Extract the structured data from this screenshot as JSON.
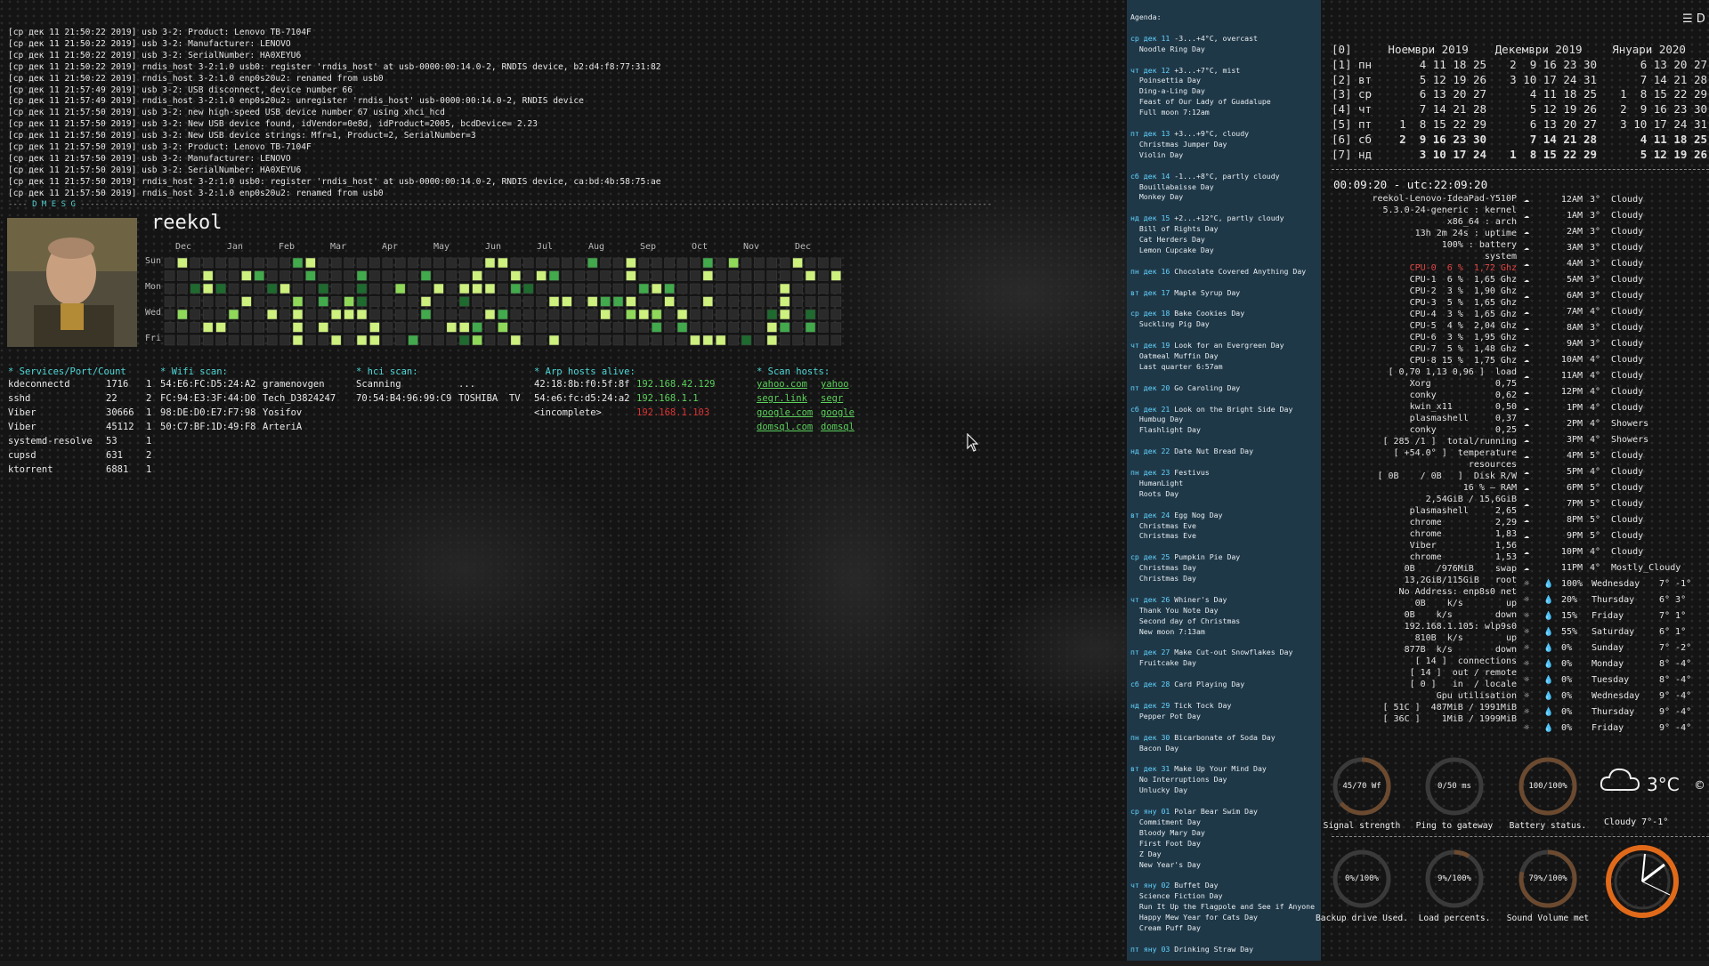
{
  "top_right": {
    "menu_label": "D"
  },
  "dmesg": {
    "lines": [
      "[ср дек 11 21:50:22 2019] usb 3-2: Product: Lenovo TB-7104F",
      "[ср дек 11 21:50:22 2019] usb 3-2: Manufacturer: LENOVO",
      "[ср дек 11 21:50:22 2019] usb 3-2: SerialNumber: HA0XEYU6",
      "[ср дек 11 21:50:22 2019] rndis_host 3-2:1.0 usb0: register 'rndis_host' at usb-0000:00:14.0-2, RNDIS device, b2:d4:f8:77:31:82",
      "[ср дек 11 21:50:22 2019] rndis_host 3-2:1.0 enp0s20u2: renamed from usb0",
      "[ср дек 11 21:57:49 2019] usb 3-2: USB disconnect, device number 66",
      "[ср дек 11 21:57:49 2019] rndis_host 3-2:1.0 enp0s20u2: unregister 'rndis_host' usb-0000:00:14.0-2, RNDIS device",
      "[ср дек 11 21:57:50 2019] usb 3-2: new high-speed USB device number 67 using xhci_hcd",
      "[ср дек 11 21:57:50 2019] usb 3-2: New USB device found, idVendor=0e8d, idProduct=2005, bcdDevice= 2.23",
      "[ср дек 11 21:57:50 2019] usb 3-2: New USB device strings: Mfr=1, Product=2, SerialNumber=3",
      "[ср дек 11 21:57:50 2019] usb 3-2: Product: Lenovo TB-7104F",
      "[ср дек 11 21:57:50 2019] usb 3-2: Manufacturer: LENOVO",
      "[ср дек 11 21:57:50 2019] usb 3-2: SerialNumber: HA0XEYU6",
      "[ср дек 11 21:57:50 2019] rndis_host 3-2:1.0 usb0: register 'rndis_host' at usb-0000:00:14.0-2, RNDIS device, ca:bd:4b:58:75:ae",
      "[ср дек 11 21:57:50 2019] rndis_host 3-2:1.0 enp0s20u2: renamed from usb0"
    ],
    "separator_label": "D M E S G"
  },
  "profile": {
    "username": "reekol",
    "months": [
      "Dec",
      "Jan",
      "Feb",
      "Mar",
      "Apr",
      "May",
      "Jun",
      "Jul",
      "Aug",
      "Sep",
      "Oct",
      "Nov",
      "Dec"
    ],
    "days": [
      "Sun",
      "Mon",
      "Wed",
      "Fri"
    ]
  },
  "services": {
    "title": "* Services/Port/Count",
    "rows": [
      [
        "kdeconnectd",
        "1716",
        "1"
      ],
      [
        "sshd",
        "22",
        "2"
      ],
      [
        "Viber",
        "30666",
        "1"
      ],
      [
        "Viber",
        "45112",
        "1"
      ],
      [
        "systemd-resolve",
        "53",
        "1"
      ],
      [
        "cupsd",
        "631",
        "2"
      ],
      [
        "ktorrent",
        "6881",
        "1"
      ]
    ]
  },
  "wifi": {
    "title": "* Wifi scan:",
    "rows": [
      [
        "54:E6:FC:D5:24:A2",
        "gramenovgen"
      ],
      [
        "FC:94:E3:3F:44:D0",
        "Tech_D3824247"
      ],
      [
        "98:DE:D0:E7:F7:98",
        "Yosifov"
      ],
      [
        "50:C7:BF:1D:49:F8",
        "ArteriA"
      ]
    ]
  },
  "hci": {
    "title": "* hci scan:",
    "rows": [
      [
        "Scanning",
        "..."
      ],
      [
        "70:54:B4:96:99:C9",
        "TOSHIBA  TV"
      ]
    ]
  },
  "arp": {
    "title": "* Arp hosts alive:",
    "rows": [
      [
        "42:18:8b:f0:5f:8f",
        "192.168.42.129",
        "green"
      ],
      [
        "54:e6:fc:d5:24:a2",
        "192.168.1.1",
        "green"
      ],
      [
        "<incomplete>",
        "192.168.1.103",
        "red"
      ]
    ]
  },
  "scan_hosts": {
    "title": "* Scan hosts:",
    "rows": [
      [
        "yahoo.com",
        "yahoo"
      ],
      [
        "segr.link",
        "segr"
      ],
      [
        "google.com",
        "google"
      ],
      [
        "domsql.com",
        "domsql"
      ]
    ]
  },
  "agenda": {
    "title": "Agenda:",
    "entries": [
      {
        "date": "ср дек 11",
        "text": "-3...+4°C, overcast\n  Noodle Ring Day"
      },
      {
        "date": "чт дек 12",
        "text": "+3...+7°C, mist\n  Poinsettia Day\n  Ding-a-Ling Day\n  Feast of Our Lady of Guadalupe\n  Full moon 7:12am"
      },
      {
        "date": "пт дек 13",
        "text": "+3...+9°C, cloudy\n  Christmas Jumper Day\n  Violin Day"
      },
      {
        "date": "сб дек 14",
        "text": "-1...+8°C, partly cloudy\n  Bouillabaisse Day\n  Monkey Day"
      },
      {
        "date": "нд дек 15",
        "text": "+2...+12°C, partly cloudy\n  Bill of Rights Day\n  Cat Herders Day\n  Lemon Cupcake Day"
      },
      {
        "date": "пн дек 16",
        "text": "Chocolate Covered Anything Day"
      },
      {
        "date": "вт дек 17",
        "text": "Maple Syrup Day"
      },
      {
        "date": "ср дек 18",
        "text": "Bake Cookies Day\n  Suckling Pig Day"
      },
      {
        "date": "чт дек 19",
        "text": "Look for an Evergreen Day\n  Oatmeal Muffin Day\n  Last quarter 6:57am"
      },
      {
        "date": "пт дек 20",
        "text": "Go Caroling Day"
      },
      {
        "date": "сб дек 21",
        "text": "Look on the Bright Side Day\n  Humbug Day\n  Flashlight Day"
      },
      {
        "date": "нд дек 22",
        "text": "Date Nut Bread Day"
      },
      {
        "date": "пн дек 23",
        "text": "Festivus\n  HumanLight\n  Roots Day"
      },
      {
        "date": "вт дек 24",
        "text": "Egg Nog Day\n  Christmas Eve\n  Christmas Eve"
      },
      {
        "date": "ср дек 25",
        "text": "Pumpkin Pie Day\n  Christmas Day\n  Christmas Day"
      },
      {
        "date": "чт дек 26",
        "text": "Whiner's Day\n  Thank You Note Day\n  Second day of Christmas\n  New moon 7:13am"
      },
      {
        "date": "пт дек 27",
        "text": "Make Cut-out Snowflakes Day\n  Fruitcake Day"
      },
      {
        "date": "сб дек 28",
        "text": "Card Playing Day"
      },
      {
        "date": "нд дек 29",
        "text": "Tick Tock Day\n  Pepper Pot Day"
      },
      {
        "date": "пн дек 30",
        "text": "Bicarbonate of Soda Day\n  Bacon Day"
      },
      {
        "date": "вт дек 31",
        "text": "Make Up Your Mind Day\n  No Interruptions Day\n  Unlucky Day"
      },
      {
        "date": "ср яну 01",
        "text": "Polar Bear Swim Day\n  Commitment Day\n  Bloody Mary Day\n  First Foot Day\n  Z Day\n  New Year's Day"
      },
      {
        "date": "чт яну 02",
        "text": "Buffet Day\n  Science Fiction Day\n  Run It Up the Flagpole and See if Anyone\n  Happy Mew Year for Cats Day\n  Cream Puff Day"
      },
      {
        "date": "пт яну 03",
        "text": "Drinking Straw Day"
      }
    ]
  },
  "calendar": {
    "row_labels": [
      "[0]",
      "[1]",
      "[2]",
      "[3]",
      "[4]",
      "[5]",
      "[6]",
      "[7]"
    ],
    "day_names": [
      "пн",
      "вт",
      "ср",
      "чт",
      "пт",
      "сб",
      "нд"
    ],
    "months": [
      {
        "title": "Ноември 2019",
        "rows": [
          "4 11 18 25",
          "5 12 19 26",
          "6 13 20 27",
          "7 14 21 28",
          "1  8 15 22 29",
          "2  9 16 23 30",
          "3 10 17 24"
        ]
      },
      {
        "title": "Декември 2019",
        "rows": [
          "2  9 16 23 30",
          "3 10 17 24 31",
          "4 11 18 25",
          "5 12 19 26",
          "6 13 20 27",
          "7 14 21 28",
          "1  8 15 22 29"
        ]
      },
      {
        "title": "Януари 2020",
        "rows": [
          "6 13 20 27",
          "7 14 21 28",
          "1  8 15 22 29",
          "2  9 16 23 30",
          "3 10 17 24 31",
          "4 11 18 25",
          "5 12 19 26"
        ]
      }
    ]
  },
  "system": {
    "clock": "00:09:20 - utc:22:09:20",
    "lines": [
      "reekol-Lenovo-IdeaPad-Y510P",
      "5.3.0-24-generic : kernel",
      "x86_64 : arch",
      "13h 2m 24s : uptime",
      "100% : battery",
      "system",
      "CPU-0  6 %  1,72 Ghz",
      "CPU-1  6 %  1,65 Ghz",
      "CPU-2  3 %  1,90 Ghz",
      "CPU-3  5 %  1,65 Ghz",
      "CPU-4  3 %  1,65 Ghz",
      "CPU-5  4 %  2,04 Ghz",
      "CPU-6  3 %  1,95 Ghz",
      "CPU-7  5 %  1,48 Ghz",
      "CPU-8 15 %  1,75 Ghz",
      "[ 0,70 1,13 0,96 ]  load",
      "Xorg            0,75",
      "conky           0,62",
      "kwin_x11        0,50",
      "plasmashell     0,37",
      "conky           0,25",
      "[ 285 /1 ]  total/running",
      "[ +54.0° ]  temperature",
      "resources",
      "[ 0B    / 0B   ]  Disk R/W",
      "16 % — RAM",
      "2,54GiB / 15,6GiB",
      "plasmashell     2,65",
      "chrome          2,29",
      "chrome          1,83",
      "Viber           1,56",
      "chrome          1,53",
      "0B    /976MiB    swap",
      "13,2GiB/115GiB   root",
      "No Address: enp8s0 net",
      "0B    k/s        up",
      "0B    k/s        down",
      "192.168.1.105: wlp9s0",
      "810B  k/s        up",
      "877B  k/s        down",
      "[ 14 ]  connections",
      "[ 14 ]  out / remote",
      "[ 0 ]   in  / locale",
      "Gpu utilisation",
      "[ 51C ]  487MiB / 1991MiB",
      "[ 36C ]    1MiB / 1999MiB"
    ]
  },
  "weather": {
    "hourly": [
      [
        "12AM",
        "3°",
        "Cloudy"
      ],
      [
        "1AM",
        "3°",
        "Cloudy"
      ],
      [
        "2AM",
        "3°",
        "Cloudy"
      ],
      [
        "3AM",
        "3°",
        "Cloudy"
      ],
      [
        "4AM",
        "3°",
        "Cloudy"
      ],
      [
        "5AM",
        "3°",
        "Cloudy"
      ],
      [
        "6AM",
        "3°",
        "Cloudy"
      ],
      [
        "7AM",
        "4°",
        "Cloudy"
      ],
      [
        "8AM",
        "3°",
        "Cloudy"
      ],
      [
        "9AM",
        "3°",
        "Cloudy"
      ],
      [
        "10AM",
        "4°",
        "Cloudy"
      ],
      [
        "11AM",
        "4°",
        "Cloudy"
      ],
      [
        "12PM",
        "4°",
        "Cloudy"
      ],
      [
        "1PM",
        "4°",
        "Cloudy"
      ],
      [
        "2PM",
        "4°",
        "Showers"
      ],
      [
        "3PM",
        "4°",
        "Showers"
      ],
      [
        "4PM",
        "5°",
        "Cloudy"
      ],
      [
        "5PM",
        "4°",
        "Cloudy"
      ],
      [
        "6PM",
        "5°",
        "Cloudy"
      ],
      [
        "7PM",
        "5°",
        "Cloudy"
      ],
      [
        "8PM",
        "5°",
        "Cloudy"
      ],
      [
        "9PM",
        "5°",
        "Cloudy"
      ],
      [
        "10PM",
        "4°",
        "Cloudy"
      ],
      [
        "11PM",
        "4°",
        "Mostly_Cloudy"
      ]
    ],
    "daily": [
      [
        "100%",
        "Wednesday",
        "7° -1°"
      ],
      [
        "20%",
        "Thursday",
        "6° 3°"
      ],
      [
        "15%",
        "Friday",
        "7° 1°"
      ],
      [
        "55%",
        "Saturday",
        "6° 1°"
      ],
      [
        "0%",
        "Sunday",
        "7° -2°"
      ],
      [
        "0%",
        "Monday",
        "8° -4°"
      ],
      [
        "0%",
        "Tuesday",
        "8° -4°"
      ],
      [
        "0%",
        "Wednesday",
        "9° -4°"
      ],
      [
        "0%",
        "Thursday",
        "9° -4°"
      ],
      [
        "0%",
        "Friday",
        "9° -4°"
      ]
    ],
    "current_temp": "3°C",
    "current_desc": "Cloudy 7°-1°"
  },
  "gauges": [
    {
      "value": "45/70 Wf",
      "label": "Signal strength",
      "fraction": 0.64
    },
    {
      "value": "0/50 ms",
      "label": "Ping to gateway",
      "fraction": 0.0
    },
    {
      "value": "100/100%",
      "label": "Battery status.",
      "fraction": 1.0
    },
    {
      "value": "0%/100%",
      "label": "Backup drive Used.",
      "fraction": 0.0
    },
    {
      "value": "9%/100%",
      "label": "Load percents.",
      "fraction": 0.09
    },
    {
      "value": "79%/100%",
      "label": "Sound Volume met",
      "fraction": 0.79
    }
  ]
}
